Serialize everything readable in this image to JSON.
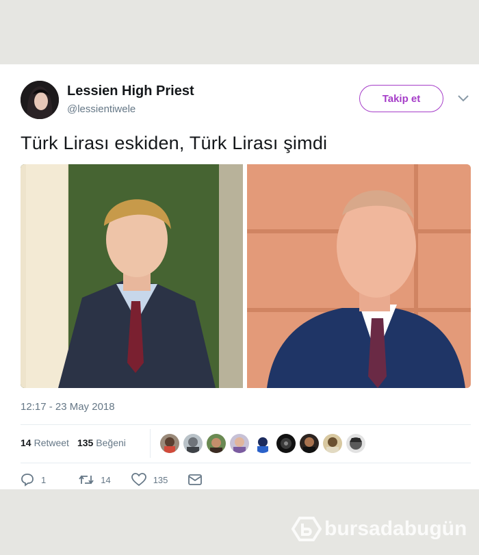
{
  "tweet": {
    "author": {
      "name": "Lessien High Priest",
      "handle": "@lessientiwele"
    },
    "follow_label": "Takip et",
    "text": "Türk Lirası eskiden, Türk Lirası şimdi",
    "timestamp": "12:17 - 23 May 2018",
    "stats": {
      "retweet_count": "14",
      "retweet_label": "Retweet",
      "like_count": "135",
      "like_label": "Beğeni"
    },
    "actions": {
      "reply_count": "1",
      "retweet_count": "14",
      "like_count": "135"
    },
    "liker_avatar_count": 9
  },
  "watermark": {
    "text": "bursadabugün"
  },
  "colors": {
    "follow_accent": "#a53cc8",
    "secondary_text": "#657786",
    "background": "#e6e6e2"
  },
  "icons": [
    "chevron-down-icon",
    "reply-icon",
    "retweet-icon",
    "heart-icon",
    "mail-icon"
  ]
}
